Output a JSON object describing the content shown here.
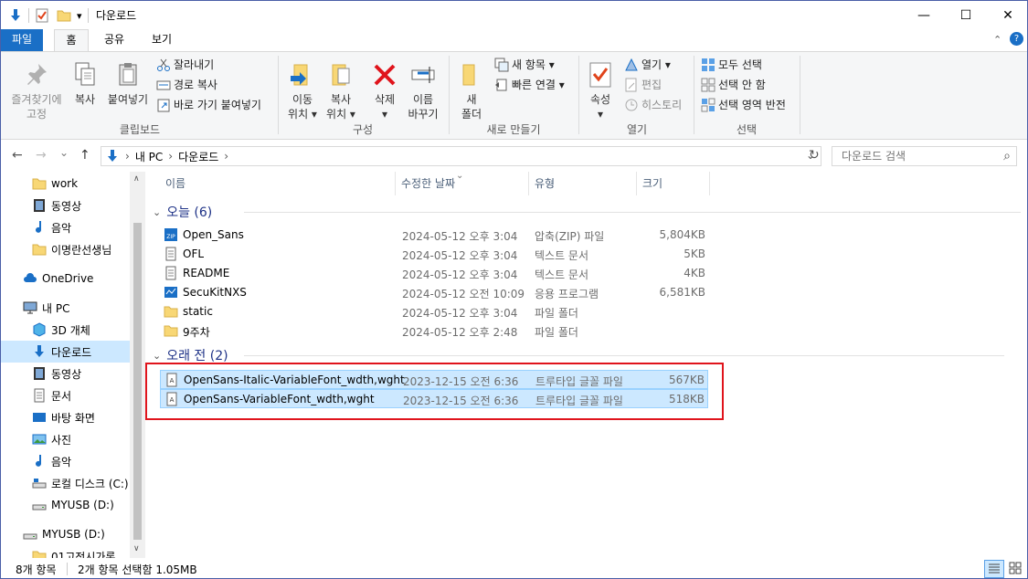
{
  "window": {
    "title": "다운로드",
    "minimize": "—",
    "maximize": "☐",
    "close": "✕",
    "qa_dropdown": "▾"
  },
  "tabs": [
    {
      "label": "파일"
    },
    {
      "label": "홈"
    },
    {
      "label": "공유"
    },
    {
      "label": "보기"
    }
  ],
  "ribbon_controls": {
    "collapse": "⌃",
    "help": "?"
  },
  "ribbon": {
    "clipboard": {
      "pin_label": "즐겨찾기에\n고정",
      "copy_label": "복사",
      "paste_label": "붙여넣기",
      "cut_label": "잘라내기",
      "copy_path_label": "경로 복사",
      "paste_shortcut_label": "바로 가기 붙여넣기",
      "group_label": "클립보드"
    },
    "organize": {
      "move_label": "이동\n위치 ▾",
      "copyto_label": "복사\n위치 ▾",
      "delete_label": "삭제\n▾",
      "rename_label": "이름\n바꾸기",
      "group_label": "구성"
    },
    "new": {
      "newfolder_label": "새\n폴더",
      "newitem_label": "새 항목 ▾",
      "easy_access_label": "빠른 연결 ▾",
      "group_label": "새로 만들기"
    },
    "open": {
      "properties_label": "속성\n▾",
      "open_label": "열기 ▾",
      "edit_label": "편집",
      "history_label": "히스토리",
      "group_label": "열기"
    },
    "select": {
      "select_all_label": "모두 선택",
      "select_none_label": "선택 안 함",
      "invert_label": "선택 영역 반전",
      "group_label": "선택"
    }
  },
  "address": {
    "back": "←",
    "forward": "→",
    "dropdown": "⌄",
    "up": "↑",
    "crumbs": [
      "내 PC",
      "다운로드"
    ],
    "crumb_sep": "›",
    "dropdown_right": "⌄",
    "refresh": "↻",
    "search_placeholder": "다운로드 검색",
    "search_icon": "⌕"
  },
  "nav_items": [
    {
      "label": "work",
      "icon": "folder-icon"
    },
    {
      "label": "동영상",
      "icon": "video-icon"
    },
    {
      "label": "음악",
      "icon": "music-icon"
    },
    {
      "label": "이명란선생님",
      "icon": "folder-icon"
    },
    {
      "label": "OneDrive",
      "icon": "cloud-icon"
    },
    {
      "label": "내 PC",
      "icon": "pc-icon"
    },
    {
      "label": "3D 개체",
      "icon": "3d-icon"
    },
    {
      "label": "다운로드",
      "icon": "download-icon"
    },
    {
      "label": "동영상",
      "icon": "video-icon"
    },
    {
      "label": "문서",
      "icon": "document-icon"
    },
    {
      "label": "바탕 화면",
      "icon": "desktop-icon"
    },
    {
      "label": "사진",
      "icon": "picture-icon"
    },
    {
      "label": "음악",
      "icon": "music-icon"
    },
    {
      "label": "로컬 디스크 (C:)",
      "icon": "drive-icon"
    },
    {
      "label": "MYUSB (D:)",
      "icon": "usb-icon"
    },
    {
      "label": "MYUSB (D:)",
      "icon": "usb-icon"
    },
    {
      "label": "01고전시가론",
      "icon": "folder-icon"
    }
  ],
  "columns": {
    "name": "이름",
    "date": "수정한 날짜",
    "type": "유형",
    "size": "크기",
    "sort_glyph": "⌄"
  },
  "groups": [
    {
      "label": "오늘 (6)",
      "files": [
        {
          "name": "Open_Sans",
          "date": "2024-05-12 오후 3:04",
          "type": "압축(ZIP) 파일",
          "size": "5,804KB",
          "icon": "zip-icon"
        },
        {
          "name": "OFL",
          "date": "2024-05-12 오후 3:04",
          "type": "텍스트 문서",
          "size": "5KB",
          "icon": "text-file-icon"
        },
        {
          "name": "README",
          "date": "2024-05-12 오후 3:04",
          "type": "텍스트 문서",
          "size": "4KB",
          "icon": "text-file-icon"
        },
        {
          "name": "SecuKitNXS",
          "date": "2024-05-12 오전 10:09",
          "type": "응용 프로그램",
          "size": "6,581KB",
          "icon": "app-icon"
        },
        {
          "name": "static",
          "date": "2024-05-12 오후 3:04",
          "type": "파일 폴더",
          "size": "",
          "icon": "folder-icon"
        },
        {
          "name": "9주차",
          "date": "2024-05-12 오후 2:48",
          "type": "파일 폴더",
          "size": "",
          "icon": "folder-icon"
        }
      ]
    },
    {
      "label": "오래 전 (2)",
      "files": [
        {
          "name": "OpenSans-Italic-VariableFont_wdth,wght",
          "date": "2023-12-15 오전 6:36",
          "type": "트루타입 글꼴 파일",
          "size": "567KB",
          "icon": "font-file-icon"
        },
        {
          "name": "OpenSans-VariableFont_wdth,wght",
          "date": "2023-12-15 오전 6:36",
          "type": "트루타입 글꼴 파일",
          "size": "518KB",
          "icon": "font-file-icon"
        }
      ]
    }
  ],
  "status": {
    "count": "8개 항목",
    "selected": "2개 항목 선택함 1.05MB"
  },
  "nav_scroll": {
    "up": "∧",
    "down": "∨"
  },
  "colors": {
    "accent": "#1a6fc6",
    "selection": "#cce8ff",
    "highlight": "#e0141c",
    "group_header": "#1e3287"
  }
}
